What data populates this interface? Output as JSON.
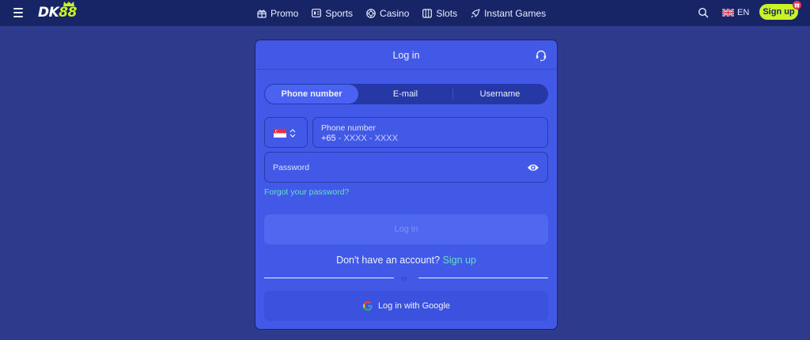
{
  "header": {
    "menu_icon": "hamburger-icon",
    "logo": {
      "part1": "DK",
      "part2": "88"
    },
    "nav": [
      {
        "label": "Promo",
        "icon": "gift-icon"
      },
      {
        "label": "Sports",
        "icon": "scoreboard-icon"
      },
      {
        "label": "Casino",
        "icon": "chip-icon"
      },
      {
        "label": "Slots",
        "icon": "slot-machine-icon"
      },
      {
        "label": "Instant Games",
        "icon": "rocket-icon"
      }
    ],
    "search_icon": "search-icon",
    "language": {
      "label": "EN",
      "flag": "uk-flag-icon"
    },
    "signup_label": "Sign up",
    "signup_badge_icon": "gift-icon"
  },
  "colors": {
    "background": "#2e3a8c",
    "topbar": "#172566",
    "modal": "#4259e8",
    "accent_lime": "#c9f227",
    "link_teal": "#5fe0c8",
    "badge_red": "#e2364a"
  },
  "modal": {
    "title": "Log in",
    "support_icon": "headset-icon",
    "tabs": [
      {
        "label": "Phone number",
        "active": true
      },
      {
        "label": "E-mail",
        "active": false
      },
      {
        "label": "Username",
        "active": false
      }
    ],
    "country": {
      "flag": "singapore-flag-icon",
      "chevron": "up-down-chevron-icon"
    },
    "phone": {
      "label": "Phone number",
      "prefix": "+65",
      "mask": " - XXXX - XXXX"
    },
    "password": {
      "label": "Password",
      "icon": "eye-icon"
    },
    "forgot_label": "Forgot your password?",
    "login_label": "Log in",
    "no_account_text": "Don't have an account?",
    "signup_link": "Sign up",
    "or_text": "or",
    "google_label": "Log in with Google",
    "google_icon": "google-icon"
  }
}
